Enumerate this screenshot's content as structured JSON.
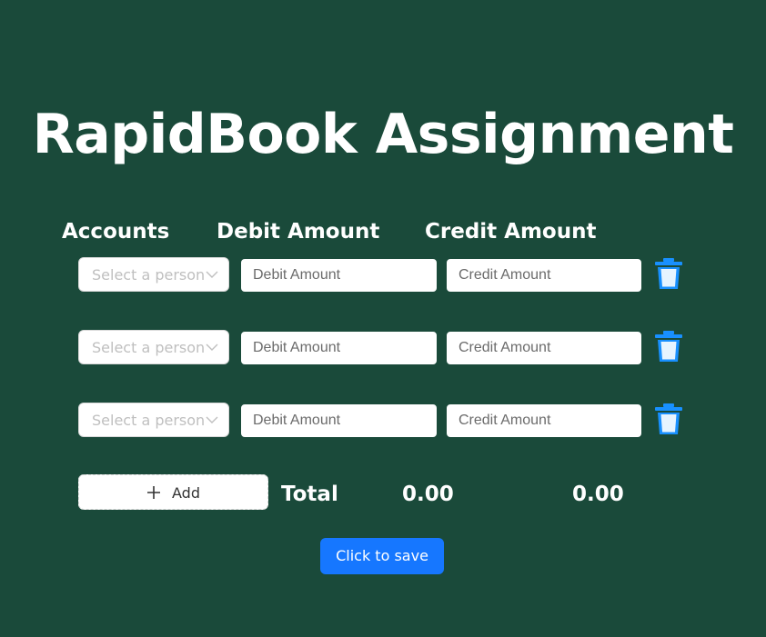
{
  "title": "RapidBook Assignment",
  "headers": {
    "accounts": "Accounts",
    "debit": "Debit Amount",
    "credit": "Credit Amount"
  },
  "rows": [
    {
      "account_placeholder": "Select a person",
      "debit_placeholder": "Debit Amount",
      "credit_placeholder": "Credit Amount"
    },
    {
      "account_placeholder": "Select a person",
      "debit_placeholder": "Debit Amount",
      "credit_placeholder": "Credit Amount"
    },
    {
      "account_placeholder": "Select a person",
      "debit_placeholder": "Debit Amount",
      "credit_placeholder": "Credit Amount"
    }
  ],
  "add_label": "Add",
  "totals": {
    "label": "Total",
    "debit": "0.00",
    "credit": "0.00"
  },
  "save_label": "Click to save",
  "colors": {
    "background": "#1a4a3a",
    "primary": "#1677ff",
    "trash_icon": "#1890ff"
  },
  "icons": {
    "row_delete": "trash-icon",
    "select_caret": "chevron-down-icon",
    "add": "plus-icon"
  }
}
